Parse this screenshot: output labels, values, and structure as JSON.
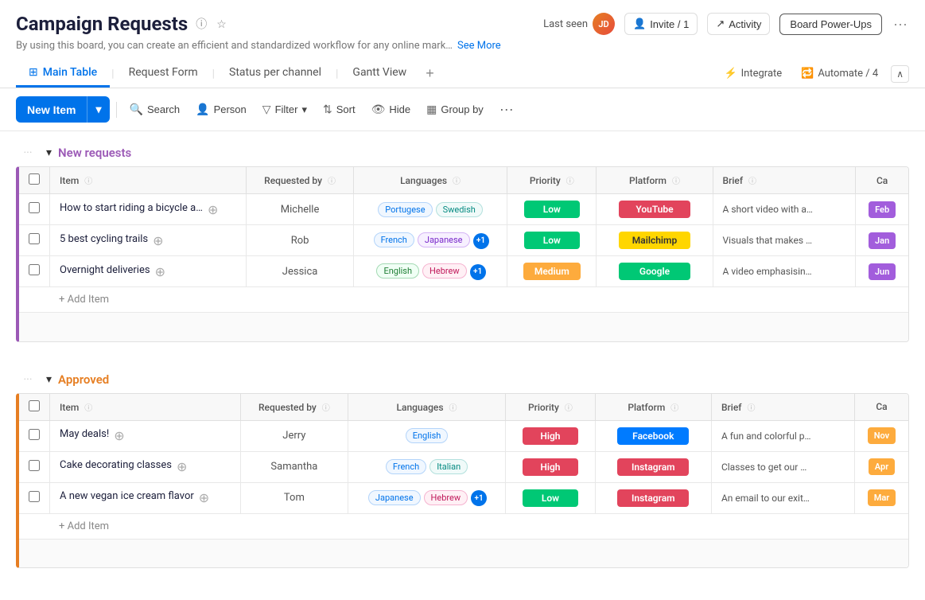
{
  "header": {
    "title": "Campaign Requests",
    "subtitle": "By using this board, you can create an efficient and standardized workflow for any online mark…",
    "see_more": "See More",
    "last_seen_label": "Last seen",
    "invite_label": "Invite / 1",
    "activity_label": "Activity",
    "board_powerups_label": "Board Power-Ups"
  },
  "tabs": [
    {
      "id": "main-table",
      "label": "Main Table",
      "icon": "⊞",
      "active": true
    },
    {
      "id": "request-form",
      "label": "Request Form",
      "active": false
    },
    {
      "id": "status-per-channel",
      "label": "Status per channel",
      "active": false
    },
    {
      "id": "gantt-view",
      "label": "Gantt View",
      "active": false
    }
  ],
  "tab_actions": {
    "integrate": "Integrate",
    "automate": "Automate / 4"
  },
  "toolbar": {
    "new_item": "New Item",
    "search": "Search",
    "person": "Person",
    "filter": "Filter",
    "sort": "Sort",
    "hide": "Hide",
    "group_by": "Group by"
  },
  "sections": [
    {
      "id": "new-requests",
      "title": "New requests",
      "color": "purple",
      "columns": [
        "Item",
        "Requested by",
        "Languages",
        "Priority",
        "Platform",
        "Brief",
        "Ca"
      ],
      "rows": [
        {
          "item": "How to start riding a bicycle at a…",
          "requested_by": "Michelle",
          "languages": [
            {
              "label": "Portugese",
              "style": "blue"
            },
            {
              "label": "Swedish",
              "style": "teal"
            }
          ],
          "priority": "Low",
          "priority_style": "low",
          "platform": "YouTube",
          "platform_style": "youtube",
          "brief": "A short video with a…",
          "ca": "Feb",
          "ca_style": "purple"
        },
        {
          "item": "5 best cycling trails",
          "requested_by": "Rob",
          "languages": [
            {
              "label": "French",
              "style": "blue"
            },
            {
              "label": "Japanese",
              "style": "purple"
            }
          ],
          "languages_extra": "+1",
          "priority": "Low",
          "priority_style": "low",
          "platform": "Mailchimp",
          "platform_style": "mailchimp",
          "brief": "Visuals that makes …",
          "ca": "Jan",
          "ca_style": "purple"
        },
        {
          "item": "Overnight deliveries",
          "requested_by": "Jessica",
          "languages": [
            {
              "label": "English",
              "style": "green"
            },
            {
              "label": "Hebrew",
              "style": "pink"
            }
          ],
          "languages_extra": "+1",
          "priority": "Medium",
          "priority_style": "medium",
          "platform": "Google",
          "platform_style": "google",
          "brief": "A video emphasisin…",
          "ca": "Jun",
          "ca_style": "purple"
        }
      ],
      "add_item": "+ Add Item"
    },
    {
      "id": "approved",
      "title": "Approved",
      "color": "orange",
      "columns": [
        "Item",
        "Requested by",
        "Languages",
        "Priority",
        "Platform",
        "Brief",
        "Ca"
      ],
      "rows": [
        {
          "item": "May deals!",
          "requested_by": "Jerry",
          "languages": [
            {
              "label": "English",
              "style": "blue"
            }
          ],
          "priority": "High",
          "priority_style": "high",
          "platform": "Facebook",
          "platform_style": "facebook",
          "brief": "A fun and colorful p…",
          "ca": "Nov",
          "ca_style": "orange"
        },
        {
          "item": "Cake decorating classes",
          "requested_by": "Samantha",
          "languages": [
            {
              "label": "French",
              "style": "blue"
            },
            {
              "label": "Italian",
              "style": "teal"
            }
          ],
          "priority": "High",
          "priority_style": "high",
          "platform": "Instagram",
          "platform_style": "instagram",
          "brief": "Classes to get our …",
          "ca": "Apr",
          "ca_style": "orange"
        },
        {
          "item": "A new vegan ice cream flavor",
          "requested_by": "Tom",
          "languages": [
            {
              "label": "Japanese",
              "style": "blue"
            },
            {
              "label": "Hebrew",
              "style": "pink"
            }
          ],
          "languages_extra": "+1",
          "priority": "Low",
          "priority_style": "low",
          "platform": "Instagram",
          "platform_style": "instagram",
          "brief": "An email to our exit…",
          "ca": "Mar",
          "ca_style": "orange"
        }
      ],
      "add_item": "+ Add Item"
    }
  ],
  "icons": {
    "chevron_down": "▾",
    "chevron_up": "▴",
    "info": "ⓘ",
    "star": "☆",
    "search": "🔍",
    "person": "👤",
    "filter": "▽",
    "sort": "⇅",
    "hide": "👁",
    "group": "▦",
    "more": "···",
    "add": "＋",
    "integrate": "⚡",
    "automate": "🔁",
    "collapse": "∧"
  },
  "colors": {
    "primary": "#0073ea",
    "purple_section": "#9b59b6",
    "orange_section": "#e67e22"
  }
}
